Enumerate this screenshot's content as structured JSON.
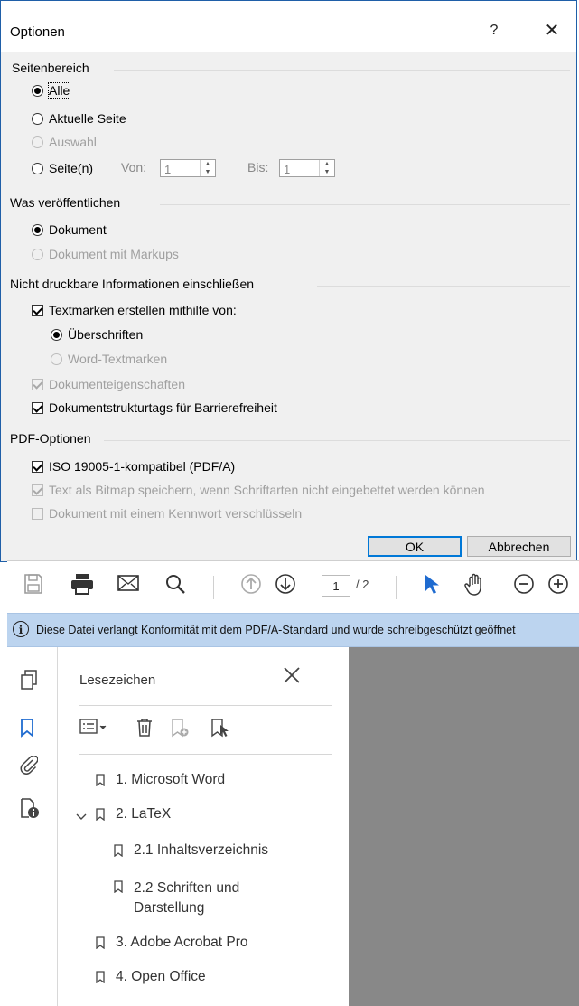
{
  "dialog": {
    "title": "Optionen",
    "help": "?",
    "close": "✕",
    "seitenbereich": {
      "heading": "Seitenbereich",
      "alle": "Alle",
      "aktuelle": "Aktuelle Seite",
      "auswahl": "Auswahl",
      "seiten": "Seite(n)",
      "von_label": "Von:",
      "von_value": "1",
      "bis_label": "Bis:",
      "bis_value": "1"
    },
    "veroeffentlichen": {
      "heading": "Was veröffentlichen",
      "dokument": "Dokument",
      "markups": "Dokument mit Markups"
    },
    "nicht_druckbar": {
      "heading": "Nicht druckbare Informationen einschließen",
      "textmarken": "Textmarken erstellen mithilfe von:",
      "ueberschriften": "Überschriften",
      "word_textmarken": "Word-Textmarken",
      "eigenschaften": "Dokumenteigenschaften",
      "strukturtags": "Dokumentstrukturtags für Barrierefreiheit"
    },
    "pdf": {
      "heading": "PDF-Optionen",
      "iso": "ISO 19005-1-kompatibel (PDF/A)",
      "bitmap": "Text als Bitmap speichern, wenn Schriftarten nicht eingebettet werden können",
      "verschluesseln": "Dokument mit einem Kennwort verschlüsseln"
    },
    "ok": "OK",
    "cancel": "Abbrechen"
  },
  "acrobat": {
    "page_current": "1",
    "page_total": "/ 2",
    "info": "Diese Datei verlangt Konformität mit dem PDF/A-Standard und wurde schreibgeschützt geöffnet",
    "bookmarks": {
      "title": "Lesezeichen",
      "items": [
        {
          "label": "1. Microsoft Word"
        },
        {
          "label": "2. LaTeX"
        },
        {
          "label": "2.1 Inhaltsverzeichnis"
        },
        {
          "label": "2.2 Schriften und\nDarstellung"
        },
        {
          "label": "3. Adobe Acrobat Pro"
        },
        {
          "label": "4. Open Office"
        }
      ]
    }
  }
}
